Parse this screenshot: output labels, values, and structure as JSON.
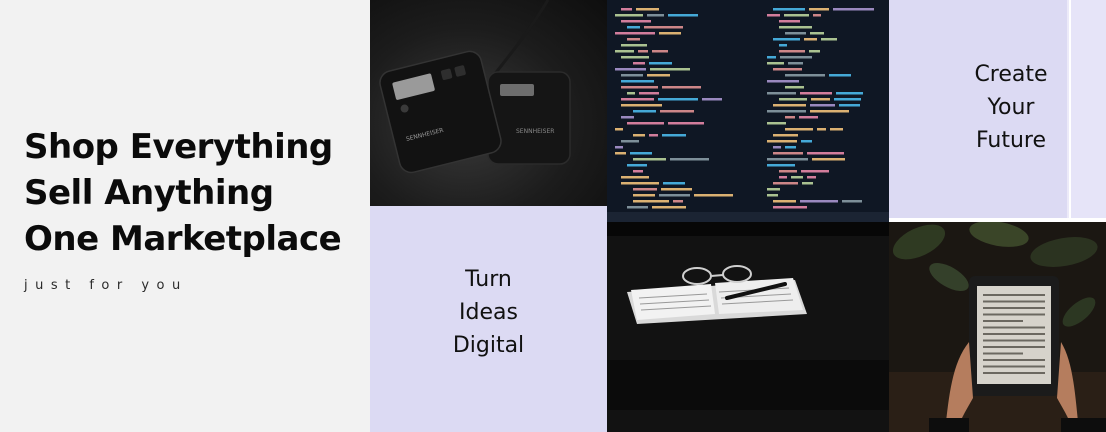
{
  "hero": {
    "title_lines": [
      "Shop Everything",
      "Sell Anything",
      "One Marketplace"
    ],
    "subtitle": "just for you"
  },
  "tile_ideas": {
    "lines": [
      "Turn",
      "Ideas",
      "Digital"
    ]
  },
  "tile_future": {
    "lines": [
      "Create",
      "Your",
      "Future"
    ]
  },
  "images": {
    "audio": {
      "icon": "audio-receivers-photo",
      "brand_text": "SENNHEISER"
    },
    "code": {
      "icon": "code-monitor-photo"
    },
    "reader": {
      "icon": "ereader-photo"
    }
  },
  "colors": {
    "hero_bg": "#f2f2f2",
    "tile_lavender": "#dcdaf3",
    "text_dark": "#0b0b0b"
  }
}
